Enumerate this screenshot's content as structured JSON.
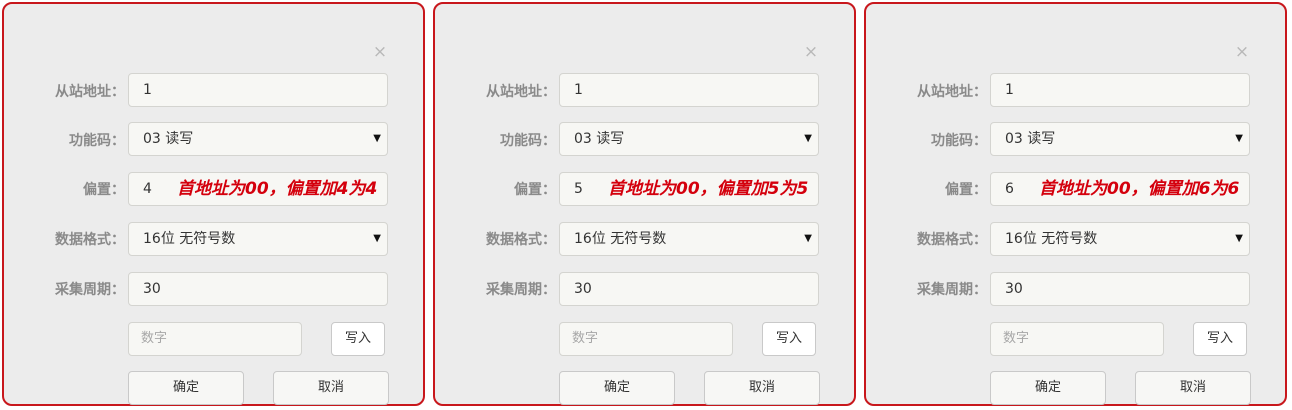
{
  "labels": {
    "slave": "从站地址：",
    "func": "功能码：",
    "offset": "偏置：",
    "format": "数据格式：",
    "period": "采集周期："
  },
  "close_symbol": "×",
  "panels": [
    {
      "slave_address": "1",
      "function_code": "03 读写",
      "offset": "4",
      "note": "首地址为00，偏置加4为4",
      "data_format": "16位 无符号数",
      "period": "30",
      "number_placeholder": "数字",
      "write_label": "写入",
      "ok_label": "确定",
      "cancel_label": "取消"
    },
    {
      "slave_address": "1",
      "function_code": "03 读写",
      "offset": "5",
      "note": "首地址为00，偏置加5为5",
      "data_format": "16位 无符号数",
      "period": "30",
      "number_placeholder": "数字",
      "write_label": "写入",
      "ok_label": "确定",
      "cancel_label": "取消"
    },
    {
      "slave_address": "1",
      "function_code": "03 读写",
      "offset": "6",
      "note": "首地址为00，偏置加6为6",
      "data_format": "16位 无符号数",
      "period": "30",
      "number_placeholder": "数字",
      "write_label": "写入",
      "ok_label": "确定",
      "cancel_label": "取消"
    }
  ],
  "colors": {
    "panel_border": "#c8171c",
    "note": "#d4000d",
    "panel_bg": "#ececec"
  }
}
